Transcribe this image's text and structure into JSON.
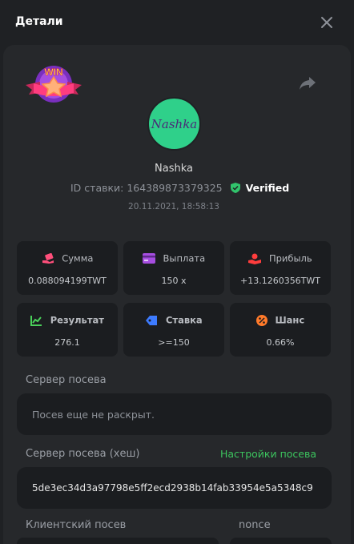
{
  "modal": {
    "title": "Детали"
  },
  "colors": {
    "accent_green": "#3cc45e",
    "verified_shield": "#31c46c",
    "avatar_bg": "#2fd08a"
  },
  "badge": {
    "text": "WIN"
  },
  "player": {
    "avatar_text": "Nashka",
    "username": "Nashka",
    "bet_id_label": "ID ставки: 164389873379325",
    "verified_label": "Verified",
    "date": "20.11.2021, 18:58:13"
  },
  "stats": [
    {
      "label": "Сумма",
      "value": "0.088094199TWT",
      "icon": "wallet-hand-icon"
    },
    {
      "label": "Выплата",
      "value": "150 x",
      "icon": "card-icon"
    },
    {
      "label": "Прибыль",
      "value": "+13.1260356TWT",
      "icon": "money-hand-icon"
    },
    {
      "label": "Результат",
      "value": "276.1",
      "icon": "chart-icon"
    },
    {
      "label": "Ставка",
      "value": ">=150",
      "icon": "tag-icon"
    },
    {
      "label": "Шанс",
      "value": "0.66%",
      "icon": "percent-icon"
    }
  ],
  "seed": {
    "server_label": "Сервер посева",
    "server_value": "Посев еще не раскрыт.",
    "hash_label": "Сервер посева (хеш)",
    "settings_link": "Настройки посева",
    "hash_value": "5de3ec34d3a97798e5ff2ecd2938b14fab33954e5a5348c9",
    "client_label": "Клиентский посев",
    "nonce_label": "nonce"
  }
}
